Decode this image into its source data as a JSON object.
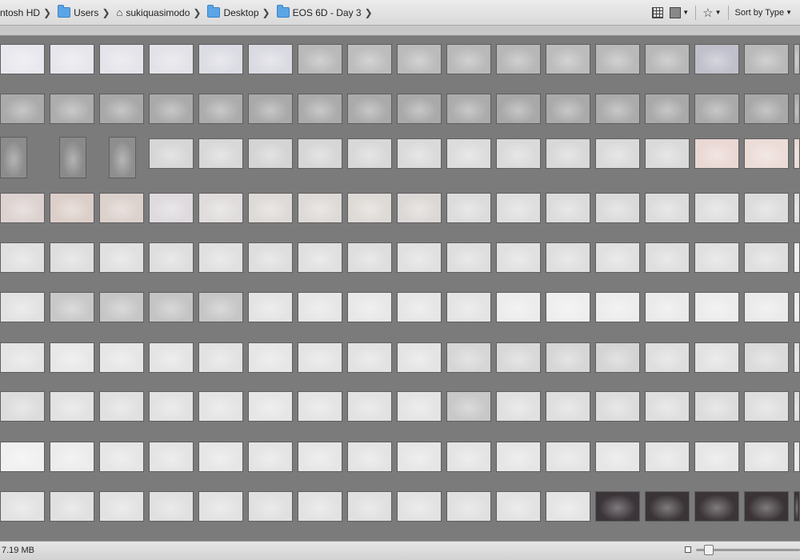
{
  "breadcrumb": [
    {
      "label": "ntosh HD",
      "icon": "drive-icon"
    },
    {
      "label": "Users",
      "icon": "folder-icon"
    },
    {
      "label": "sukiquasimodo",
      "icon": "home-icon"
    },
    {
      "label": "Desktop",
      "icon": "folder-icon"
    },
    {
      "label": "EOS 6D - Day 3",
      "icon": "folder-icon"
    }
  ],
  "toolbar": {
    "sort_label": "Sort by Type",
    "icons": [
      "grid-view-icon",
      "view-options-icon",
      "star-filter-icon"
    ]
  },
  "status": {
    "size_label": "7.19 MB"
  },
  "thumbnails": {
    "rows": 10,
    "columns": 17,
    "row_tones": [
      [
        "#e8e8ee",
        "#e6e6ec",
        "#e4e4ea",
        "#e2e2e8",
        "#dcdce4",
        "#dadae2",
        "#b9b9b9",
        "#bdbdbd",
        "#bbbbbb",
        "#b9b9b9",
        "#b7b7b7",
        "#bcbcbc",
        "#b9b9b9",
        "#b8b8b8",
        "#c0c0cc",
        "#b9b9b9",
        "#bababa"
      ],
      [
        "#aaaaaa",
        "#adadad",
        "#a8a8a8",
        "#aaaaaa",
        "#acacac",
        "#a9a9a9",
        "#ababab",
        "#aaaaaa",
        "#a9a9a9",
        "#acacac",
        "#a8a8a8",
        "#aaaaaa",
        "#ababab",
        "#a9a9a9",
        "#aaaaaa",
        "#a8a8a8",
        "#aaaaaa"
      ],
      [
        "#8c8c8c",
        "#8a8a8a",
        "#8e8e8e",
        "#d6d6d6",
        "#d8d8d8",
        "#d4d4d4",
        "#d6d6d6",
        "#d8d8d8",
        "#dadada",
        "#dcdcdc",
        "#dadada",
        "#d8d8d8",
        "#dadada",
        "#dadada",
        "#ead8d4",
        "#ecdcd8",
        "#eadad6"
      ],
      [
        "#ddd2d0",
        "#dccfca",
        "#dcd1cc",
        "#dedade",
        "#e0dcdc",
        "#dedad8",
        "#dedad8",
        "#dedad6",
        "#dcd8d6",
        "#dcdcdc",
        "#dedede",
        "#dcdcdc",
        "#dadada",
        "#dcdcdc",
        "#dedede",
        "#dcdcdc",
        "#dedede"
      ],
      [
        "#e0e0e0",
        "#dedede",
        "#e0e0e0",
        "#dedede",
        "#e0e0e0",
        "#dedede",
        "#e0e0e0",
        "#dedede",
        "#e0e0e0",
        "#dedede",
        "#e0e0e0",
        "#dedede",
        "#e0e0e0",
        "#dedede",
        "#e0e0e0",
        "#dedede",
        "#ececec"
      ],
      [
        "#e2e2e2",
        "#c8c8c8",
        "#c6c6c6",
        "#c4c4c4",
        "#c6c6c6",
        "#e4e4e4",
        "#e6e6e6",
        "#e8e8e8",
        "#e6e6e6",
        "#e4e4e4",
        "#ececec",
        "#eeeeee",
        "#ececec",
        "#eaeaea",
        "#ececec",
        "#eaeaea",
        "#ececec"
      ],
      [
        "#e4e4e4",
        "#e8e8e8",
        "#e6e6e6",
        "#e4e4e4",
        "#e2e2e2",
        "#e6e6e6",
        "#e4e4e4",
        "#e2e2e2",
        "#e4e4e4",
        "#d6d6d6",
        "#d8d8d8",
        "#d6d6d6",
        "#d4d4d4",
        "#dedede",
        "#e2e2e2",
        "#dadada",
        "#e0e0e0"
      ],
      [
        "#dcdcdc",
        "#e2e2e2",
        "#e0e0e0",
        "#e2e2e2",
        "#e4e4e4",
        "#e6e6e6",
        "#e4e4e4",
        "#e2e2e2",
        "#e4e4e4",
        "#c8c8c8",
        "#e0e0e0",
        "#dedede",
        "#dcdcdc",
        "#dedede",
        "#dcdcdc",
        "#dedede",
        "#dcdcdc"
      ],
      [
        "#f0f0f0",
        "#ececec",
        "#e6e6e6",
        "#e4e4e4",
        "#e6e6e6",
        "#e4e4e4",
        "#e6e6e6",
        "#e4e4e4",
        "#e6e6e6",
        "#e4e4e4",
        "#e6e6e6",
        "#e4e4e4",
        "#e6e6e6",
        "#e4e4e4",
        "#e6e6e6",
        "#e4e4e4",
        "#e6e6e6"
      ],
      [
        "#e2e2e2",
        "#e0e0e0",
        "#e2e2e2",
        "#e0e0e0",
        "#e2e2e2",
        "#e0e0e0",
        "#e2e2e2",
        "#e0e0e0",
        "#e2e2e2",
        "#e0e0e0",
        "#e2e2e2",
        "#e4e4e4",
        "#3b3438",
        "#3a3437",
        "#3c3538",
        "#3a3437",
        "#3b3538"
      ]
    ]
  }
}
